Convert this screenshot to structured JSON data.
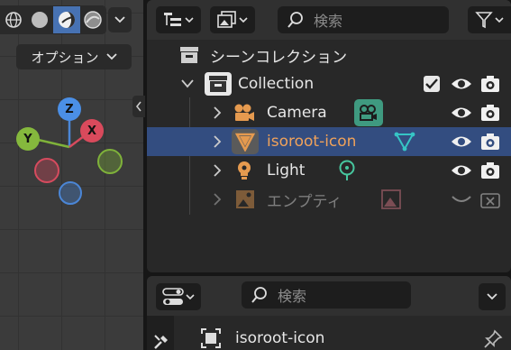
{
  "viewport": {
    "options_label": "オプション",
    "gizmo": {
      "z_label": "Z",
      "y_label": "Y",
      "x_label": "X"
    }
  },
  "outliner": {
    "search_placeholder": "検索",
    "rows": {
      "scene_collection": "シーンコレクション",
      "collection": "Collection",
      "camera": "Camera",
      "isoroot": "isoroot-icon",
      "light": "Light",
      "empty": "エンプティ"
    }
  },
  "properties": {
    "search_placeholder": "検索",
    "object_name": "isoroot-icon"
  },
  "colors": {
    "selection": "#334d80",
    "accent_blue": "#4772b3",
    "object_orange": "#e59a4f",
    "mesh_teal": "#36c5c5",
    "camera_green": "#3f9a80",
    "light_green": "#47c69e"
  }
}
